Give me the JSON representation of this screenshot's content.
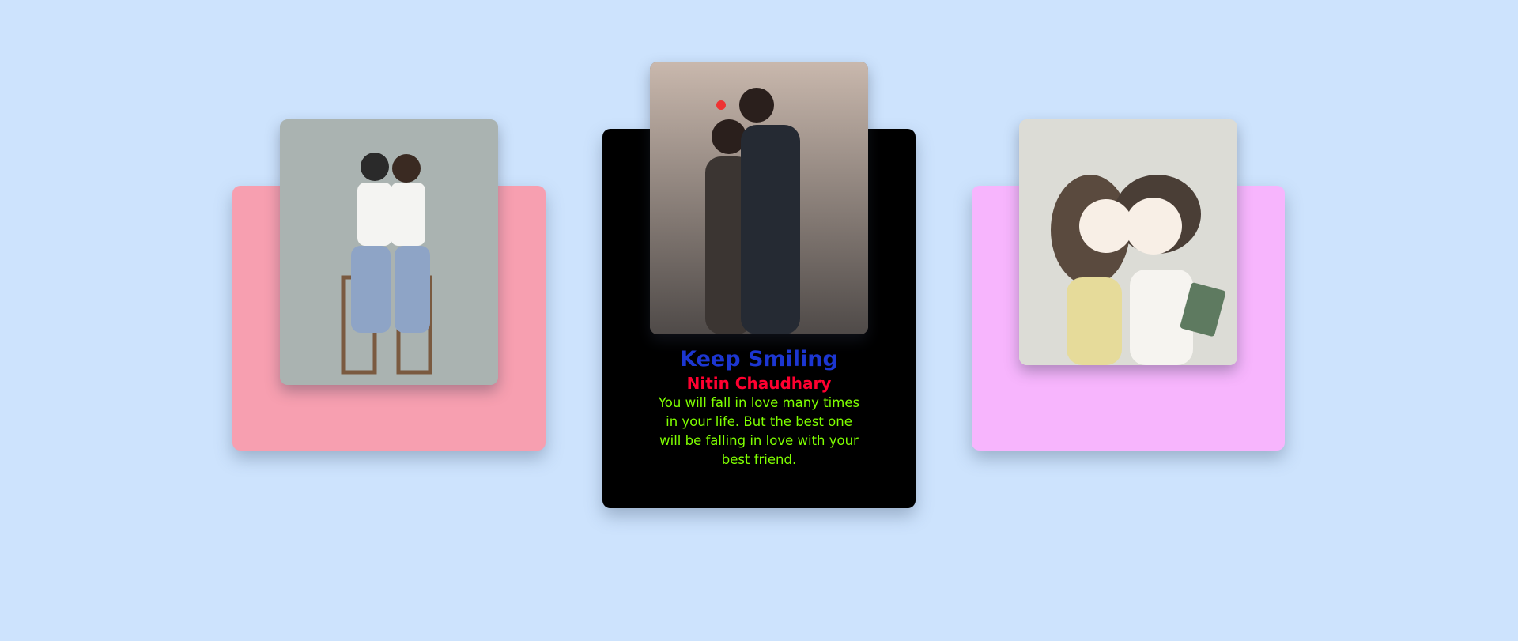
{
  "cards": [
    {
      "id": "left",
      "color": "#f79fb0",
      "image": "couple-illustration-stools"
    },
    {
      "id": "center",
      "color": "#000000",
      "image": "couple-photo-street",
      "title": "Keep Smiling",
      "name": "Nitin Chaudhary",
      "text": "You will fall in love many times in your life. But the best one will be falling in love with your best friend."
    },
    {
      "id": "right",
      "color": "#f7b5fd",
      "image": "cartoon-couple-book"
    }
  ],
  "colors": {
    "background": "#cde3fd",
    "title": "#1c36d1",
    "name": "#ff0030",
    "text": "#7fff00"
  }
}
